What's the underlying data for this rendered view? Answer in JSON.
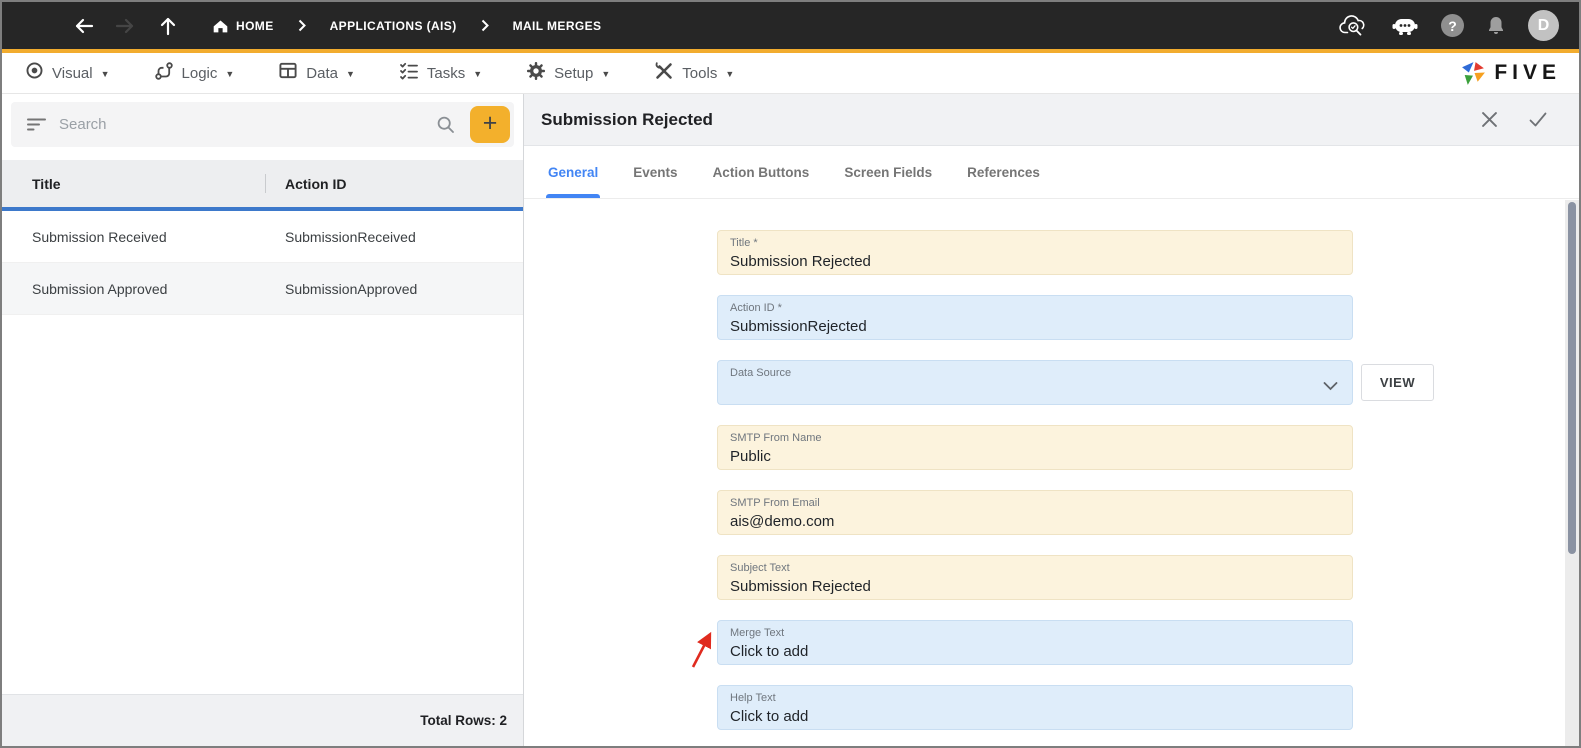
{
  "colors": {
    "navbar_bg": "#262626",
    "accent_yellow": "#F2AC2E",
    "accent_blue": "#4285F4",
    "table_header_underline": "#3D79CB",
    "field_cream_bg": "#FCF3DD",
    "field_blue_bg": "#DFEDFA",
    "annotation_red": "#E02B1F"
  },
  "topbar": {
    "icons": [
      "hamburger-icon",
      "back-icon",
      "forward-icon",
      "up-icon",
      "home-icon",
      "cloud-search-icon",
      "assistant-icon",
      "help-icon",
      "notifications-icon",
      "avatar"
    ],
    "breadcrumbs": [
      {
        "label": "HOME"
      },
      {
        "label": "APPLICATIONS (AIS)"
      },
      {
        "label": "MAIL MERGES"
      }
    ],
    "help_glyph": "?",
    "avatar_initial": "D"
  },
  "menubar": {
    "caret": "▼",
    "items": [
      {
        "label": "Visual",
        "icon": "visual-icon"
      },
      {
        "label": "Logic",
        "icon": "logic-icon"
      },
      {
        "label": "Data",
        "icon": "data-icon"
      },
      {
        "label": "Tasks",
        "icon": "tasks-icon"
      },
      {
        "label": "Setup",
        "icon": "setup-icon"
      },
      {
        "label": "Tools",
        "icon": "tools-icon"
      }
    ],
    "logo_text": "FIVE"
  },
  "left_panel": {
    "search_placeholder": "Search",
    "add_button_glyph": "+",
    "table": {
      "columns": [
        {
          "label": "Title"
        },
        {
          "label": "Action ID"
        }
      ],
      "rows": [
        {
          "title": "Submission Received",
          "action_id": "SubmissionReceived"
        },
        {
          "title": "Submission Approved",
          "action_id": "SubmissionApproved"
        }
      ]
    },
    "footer_total": "Total Rows: 2"
  },
  "right_panel": {
    "title": "Submission Rejected",
    "active_tab": "General",
    "tabs": [
      {
        "label": "General"
      },
      {
        "label": "Events"
      },
      {
        "label": "Action Buttons"
      },
      {
        "label": "Screen Fields"
      },
      {
        "label": "References"
      }
    ],
    "fields": [
      {
        "label": "Title *",
        "value": "Submission Rejected",
        "style": "cream"
      },
      {
        "label": "Action ID *",
        "value": "SubmissionRejected",
        "style": "blue"
      },
      {
        "label": "Data Source",
        "value": "",
        "style": "blue",
        "has_dropdown": true
      },
      {
        "label": "SMTP From Name",
        "value": "Public",
        "style": "cream"
      },
      {
        "label": "SMTP From Email",
        "value": "ais@demo.com",
        "style": "cream"
      },
      {
        "label": "Subject Text",
        "value": "Submission Rejected",
        "style": "cream"
      },
      {
        "label": "Merge Text",
        "value": "Click to add",
        "style": "blue",
        "annotated": true
      },
      {
        "label": "Help Text",
        "value": "Click to add",
        "style": "blue"
      }
    ],
    "view_button_label": "VIEW"
  }
}
